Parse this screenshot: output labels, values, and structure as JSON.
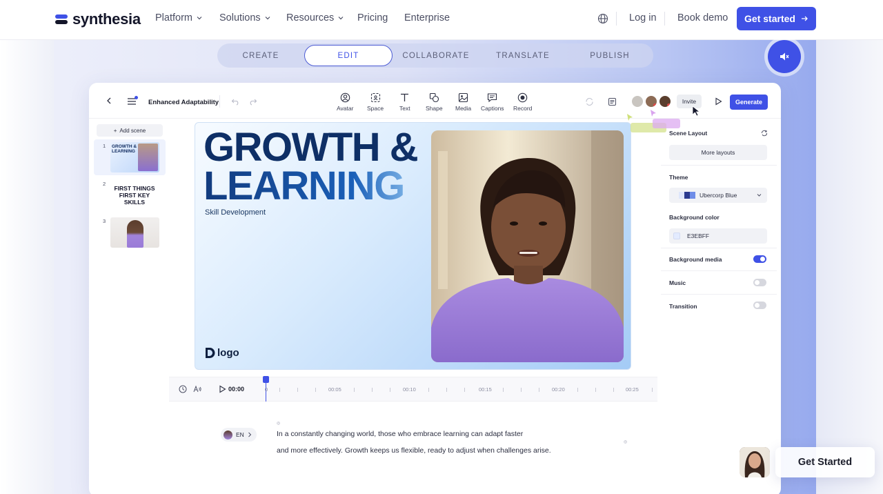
{
  "nav": {
    "logo_text": "synthesia",
    "items": [
      {
        "label": "Platform",
        "dropdown": true
      },
      {
        "label": "Solutions",
        "dropdown": true
      },
      {
        "label": "Resources",
        "dropdown": true
      },
      {
        "label": "Pricing",
        "dropdown": false
      },
      {
        "label": "Enterprise",
        "dropdown": false
      }
    ],
    "login": "Log in",
    "book_demo": "Book demo",
    "get_started": "Get started",
    "accent": "#3f51e6"
  },
  "steps": [
    "CREATE",
    "EDIT",
    "COLLABORATE",
    "TRANSLATE",
    "PUBLISH"
  ],
  "active_step": "EDIT",
  "editor": {
    "project_title": "Enhanced Adaptability",
    "tools": [
      "Avatar",
      "Space",
      "Text",
      "Shape",
      "Media",
      "Captions",
      "Record"
    ],
    "invite": "Invite",
    "generate": "Generate"
  },
  "scenes": {
    "add_scene": "Add scene",
    "items": [
      {
        "num": "1",
        "text": "GROWTH & LEARNING"
      },
      {
        "num": "2",
        "text": "FIRST THINGS FIRST KEY SKILLS"
      },
      {
        "num": "3",
        "text": ""
      }
    ]
  },
  "canvas": {
    "headline_line1": "GROWTH &",
    "headline_line2": "LEARNING",
    "subhead": "Skill Development",
    "logo": "logo"
  },
  "panel": {
    "scene_layout": "Scene Layout",
    "more_layouts": "More layouts",
    "theme_label": "Theme",
    "theme_value": "Ubercorp Blue",
    "bg_color_label": "Background color",
    "bg_color_value": "E3EBFF",
    "bg_media_label": "Background media",
    "bg_media_on": true,
    "music_label": "Music",
    "music_on": false,
    "transition_label": "Transition",
    "transition_on": false
  },
  "timeline": {
    "current_time": "00:00",
    "ticks": [
      "0",
      "00:05",
      "00:10",
      "00:15",
      "00:20",
      "00:25"
    ]
  },
  "script": {
    "language": "EN",
    "line1": "In a constantly changing world, those who embrace learning can adapt faster",
    "line2": "and more effectively. Growth keeps us flexible, ready to adjust when challenges arise."
  },
  "floating_cta": "Get Started"
}
